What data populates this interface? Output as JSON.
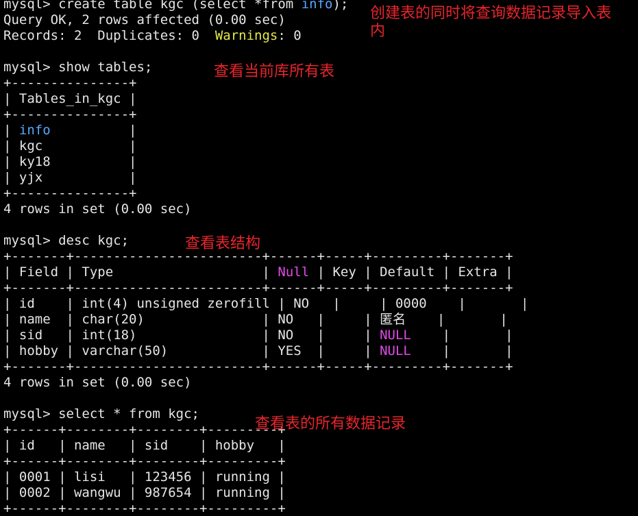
{
  "theme": {
    "background": "#000000",
    "text": "#e6e6e6",
    "highlight_blue": "#5aa7ff",
    "highlight_yellow": "#e7e94a",
    "highlight_magenta": "#e34ae8",
    "annotation_red": "#e8252b"
  },
  "terminal": {
    "lines": [
      [
        {
          "text": "mysql> create table kgc (select *from ",
          "color": "#e6e6e6"
        },
        {
          "text": "info",
          "color": "#5aa7ff"
        },
        {
          "text": ");",
          "color": "#e6e6e6"
        }
      ],
      [
        {
          "text": "Query OK, 2 rows affected (0.00 sec)",
          "color": "#e6e6e6"
        }
      ],
      [
        {
          "text": "Records: 2  Duplicates: 0  ",
          "color": "#e6e6e6"
        },
        {
          "text": "Warnings",
          "color": "#e7e94a"
        },
        {
          "text": ": 0",
          "color": "#e6e6e6"
        }
      ],
      [
        {
          "text": "",
          "color": "#e6e6e6"
        }
      ],
      [
        {
          "text": "mysql> show tables;",
          "color": "#e6e6e6"
        }
      ],
      [
        {
          "text": "+---------------+",
          "color": "#e6e6e6"
        }
      ],
      [
        {
          "text": "| Tables_in_kgc |",
          "color": "#e6e6e6"
        }
      ],
      [
        {
          "text": "+---------------+",
          "color": "#e6e6e6"
        }
      ],
      [
        {
          "text": "| ",
          "color": "#e6e6e6"
        },
        {
          "text": "info",
          "color": "#5aa7ff"
        },
        {
          "text": "          |",
          "color": "#e6e6e6"
        }
      ],
      [
        {
          "text": "| kgc           |",
          "color": "#e6e6e6"
        }
      ],
      [
        {
          "text": "| ky18          |",
          "color": "#e6e6e6"
        }
      ],
      [
        {
          "text": "| yjx           |",
          "color": "#e6e6e6"
        }
      ],
      [
        {
          "text": "+---------------+",
          "color": "#e6e6e6"
        }
      ],
      [
        {
          "text": "4 rows in set (0.00 sec)",
          "color": "#e6e6e6"
        }
      ],
      [
        {
          "text": "",
          "color": "#e6e6e6"
        }
      ],
      [
        {
          "text": "mysql> desc kgc;",
          "color": "#e6e6e6"
        }
      ],
      [
        {
          "text": "+-------+------------------------+------+-----+---------+-------+",
          "color": "#e6e6e6"
        }
      ],
      [
        {
          "text": "| Field | Type                   | ",
          "color": "#e6e6e6"
        },
        {
          "text": "Null",
          "color": "#e34ae8"
        },
        {
          "text": " | Key | Default | Extra |",
          "color": "#e6e6e6"
        }
      ],
      [
        {
          "text": "+-------+------------------------+------+-----+---------+-------+",
          "color": "#e6e6e6"
        }
      ],
      [
        {
          "text": "| id    | int(4) unsigned zerofill | NO   |     | 0000    |       |",
          "color": "#e6e6e6"
        }
      ],
      [
        {
          "text": "| name  | char(20)               | NO   |     | 匿名    |       |",
          "color": "#e6e6e6"
        }
      ],
      [
        {
          "text": "| sid   | int(18)                | NO   |     | ",
          "color": "#e6e6e6"
        },
        {
          "text": "NULL",
          "color": "#e34ae8"
        },
        {
          "text": "    |       |",
          "color": "#e6e6e6"
        }
      ],
      [
        {
          "text": "| hobby | varchar(50)            | YES  |     | ",
          "color": "#e6e6e6"
        },
        {
          "text": "NULL",
          "color": "#e34ae8"
        },
        {
          "text": "    |       |",
          "color": "#e6e6e6"
        }
      ],
      [
        {
          "text": "+-------+------------------------+------+-----+---------+-------+",
          "color": "#e6e6e6"
        }
      ],
      [
        {
          "text": "4 rows in set (0.00 sec)",
          "color": "#e6e6e6"
        }
      ],
      [
        {
          "text": "",
          "color": "#e6e6e6"
        }
      ],
      [
        {
          "text": "mysql> select * from kgc;",
          "color": "#e6e6e6"
        }
      ],
      [
        {
          "text": "+------+--------+--------+---------+",
          "color": "#e6e6e6"
        }
      ],
      [
        {
          "text": "| id   | name   | sid    | hobby   |",
          "color": "#e6e6e6"
        }
      ],
      [
        {
          "text": "+------+--------+--------+---------+",
          "color": "#e6e6e6"
        }
      ],
      [
        {
          "text": "| 0001 | lisi   | 123456 | running |",
          "color": "#e6e6e6"
        }
      ],
      [
        {
          "text": "| 0002 | wangwu | 987654 | running |",
          "color": "#e6e6e6"
        }
      ],
      [
        {
          "text": "+------+--------+--------+---------+",
          "color": "#e6e6e6"
        }
      ]
    ]
  },
  "annotations": {
    "create_table": "创建表的同时将查询数据记录导入表\n内",
    "show_tables": "查看当前库所有表",
    "desc_table": "查看表结构",
    "select_all": "查看表的所有数据记录"
  }
}
